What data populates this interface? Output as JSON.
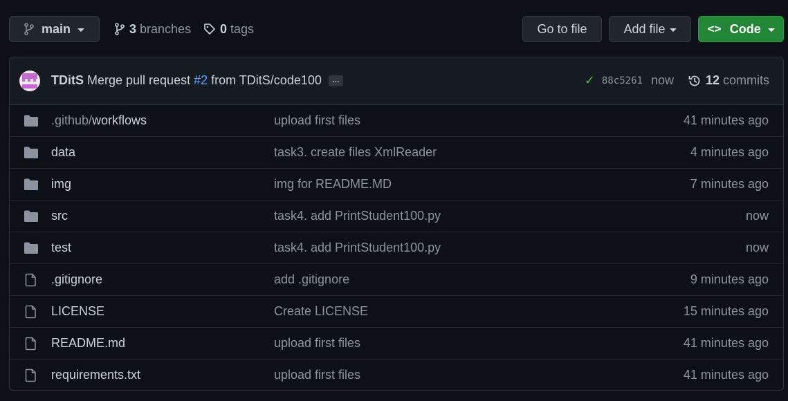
{
  "topbar": {
    "branch_label": "main",
    "branches_count": "3",
    "branches_label": "branches",
    "tags_count": "0",
    "tags_label": "tags",
    "goto_file_label": "Go to file",
    "add_file_label": "Add file",
    "code_label": "Code",
    "code_button_color": "#238636"
  },
  "latest_commit": {
    "author": "TDitS",
    "message_prefix": "Merge pull request",
    "pr_ref": "#2",
    "message_suffix": "from TDitS/code100",
    "ellipsis": "…",
    "sha": "88c5261",
    "time": "now",
    "commits_count": "12",
    "commits_label": "commits"
  },
  "files": [
    {
      "type": "folder",
      "name_prefix": ".github/",
      "name": "workflows",
      "message": "upload first files",
      "age": "41 minutes ago"
    },
    {
      "type": "folder",
      "name_prefix": "",
      "name": "data",
      "message": "task3. create files XmlReader",
      "age": "4 minutes ago"
    },
    {
      "type": "folder",
      "name_prefix": "",
      "name": "img",
      "message": "img for README.MD",
      "age": "7 minutes ago"
    },
    {
      "type": "folder",
      "name_prefix": "",
      "name": "src",
      "message": "task4. add PrintStudent100.py",
      "age": "now"
    },
    {
      "type": "folder",
      "name_prefix": "",
      "name": "test",
      "message": "task4. add PrintStudent100.py",
      "age": "now"
    },
    {
      "type": "file",
      "name_prefix": "",
      "name": ".gitignore",
      "message": "add .gitignore",
      "age": "9 minutes ago"
    },
    {
      "type": "file",
      "name_prefix": "",
      "name": "LICENSE",
      "message": "Create LICENSE",
      "age": "15 minutes ago"
    },
    {
      "type": "file",
      "name_prefix": "",
      "name": "README.md",
      "message": "upload first files",
      "age": "41 minutes ago"
    },
    {
      "type": "file",
      "name_prefix": "",
      "name": "requirements.txt",
      "message": "upload first files",
      "age": "41 minutes ago"
    }
  ],
  "colors": {
    "background": "#0d1117",
    "link": "#58a6ff",
    "success": "#3fb950",
    "muted": "#8b949e"
  }
}
